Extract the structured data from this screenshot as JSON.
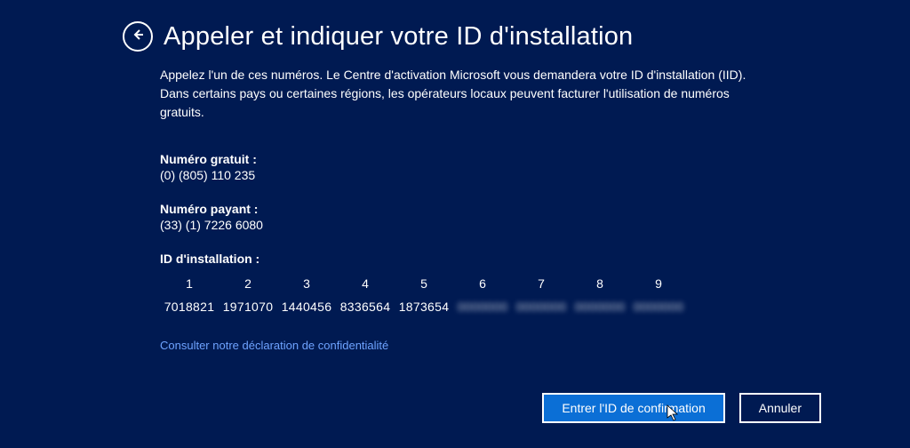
{
  "header": {
    "title": "Appeler et indiquer votre ID d'installation"
  },
  "description": "Appelez l'un de ces numéros. Le Centre d'activation Microsoft vous demandera votre ID d'installation (IID). Dans certains pays ou certaines régions, les opérateurs locaux peuvent facturer l'utilisation de numéros gratuits.",
  "free_number": {
    "label": "Numéro gratuit :",
    "value": "(0) (805) 110 235"
  },
  "paid_number": {
    "label": "Numéro payant :",
    "value": "(33) (1) 7226 6080"
  },
  "installation_id": {
    "label": "ID d'installation :",
    "columns": [
      {
        "n": "1",
        "v": "7018821"
      },
      {
        "n": "2",
        "v": "1971070"
      },
      {
        "n": "3",
        "v": "1440456"
      },
      {
        "n": "4",
        "v": "8336564"
      },
      {
        "n": "5",
        "v": "1873654"
      },
      {
        "n": "6",
        "v": "0000000"
      },
      {
        "n": "7",
        "v": "0000000"
      },
      {
        "n": "8",
        "v": "0000000"
      },
      {
        "n": "9",
        "v": "0000000"
      }
    ]
  },
  "privacy_link": "Consulter notre déclaration de confidentialité",
  "buttons": {
    "confirm": "Entrer l'ID de confirmation",
    "cancel": "Annuler"
  }
}
